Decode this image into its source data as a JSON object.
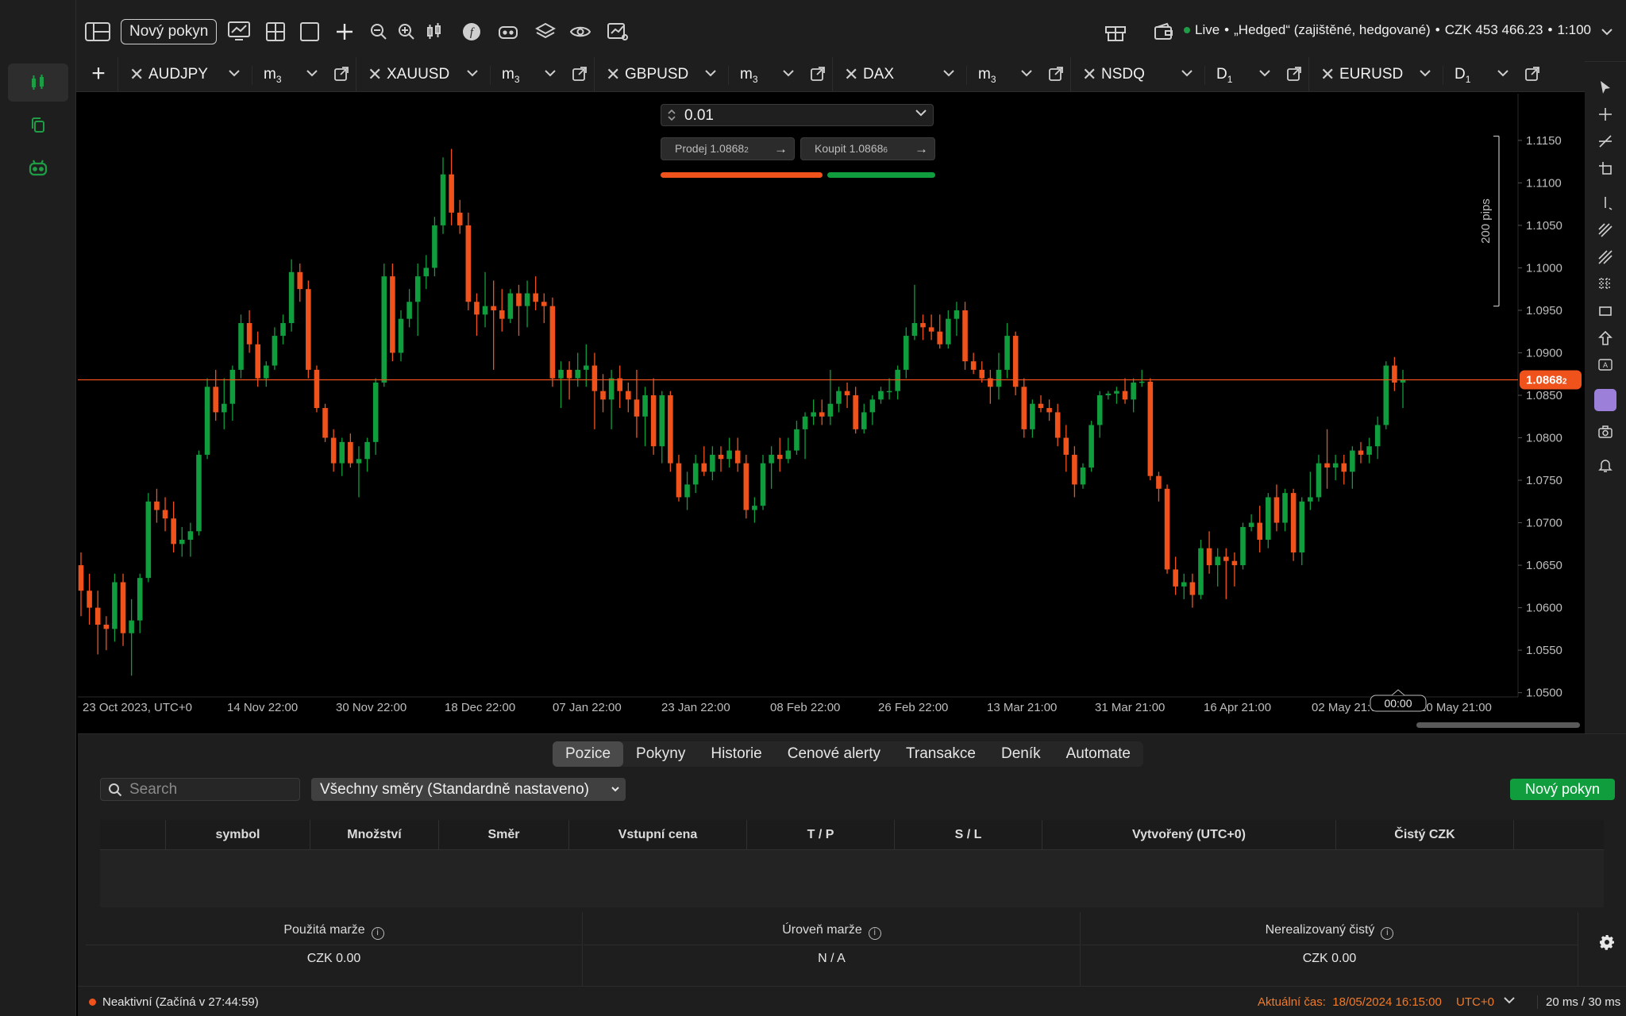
{
  "toolbar": {
    "new_order_label": "Nový pokyn",
    "account_status": "Live",
    "account_name": "„Hedged“ (zajištěné, hedgované)",
    "balance": "CZK 453 466.23",
    "leverage": "1:100",
    "icons": [
      "sidebar-toggle-icon",
      "chart-icon",
      "layout-grid-icon",
      "single-layout-icon",
      "crosshair-add-icon",
      "zoom-out-icon",
      "zoom-in-icon",
      "candles-icon",
      "indicator-f-icon",
      "bot-icon",
      "layers-icon",
      "eye-icon",
      "chart-settings-icon",
      "gift-icon",
      "wallet-icon"
    ]
  },
  "left_sidebar": {
    "items": [
      "trading-icon",
      "copy-icon",
      "automate-icon"
    ]
  },
  "tabs": [
    {
      "symbol": "AUDJPY",
      "timeframe": "m",
      "tf_sub": "3"
    },
    {
      "symbol": "XAUUSD",
      "timeframe": "m",
      "tf_sub": "3"
    },
    {
      "symbol": "GBPUSD",
      "timeframe": "m",
      "tf_sub": "3"
    },
    {
      "symbol": "DAX",
      "timeframe": "m",
      "tf_sub": "3"
    },
    {
      "symbol": "NSDQ",
      "timeframe": "D",
      "tf_sub": "1"
    },
    {
      "symbol": "EURUSD",
      "timeframe": "D",
      "tf_sub": "1"
    }
  ],
  "trade_panel": {
    "quantity": "0.01",
    "sell_label": "Prodej 1.0868",
    "sell_sup": "2",
    "buy_label": "Koupit 1.0868",
    "buy_sup": "6"
  },
  "chart_data": {
    "type": "candlestick",
    "symbol": "EURUSD",
    "timeframe": "D1",
    "y_ticks": [
      "1.1150",
      "1.1100",
      "1.1050",
      "1.1000",
      "1.0950",
      "1.0900",
      "1.0850",
      "1.0800",
      "1.0750",
      "1.0700",
      "1.0650",
      "1.0600",
      "1.0550",
      "1.0500"
    ],
    "y_tick_values": [
      1.115,
      1.11,
      1.105,
      1.1,
      1.095,
      1.09,
      1.085,
      1.08,
      1.075,
      1.07,
      1.065,
      1.06,
      1.055,
      1.05
    ],
    "ylim": [
      1.0495,
      1.1205
    ],
    "x_tick_labels": [
      "23 Oct 2023, UTC+0",
      "14 Nov 22:00",
      "30 Nov 22:00",
      "18 Dec 22:00",
      "07 Jan 22:00",
      "23 Jan 22:00",
      "08 Feb 22:00",
      "26 Feb 22:00",
      "13 Mar 21:00",
      "31 Mar 21:00",
      "16 Apr 21:00",
      "02 May 21:00",
      "20 May 21:00"
    ],
    "current_price": "1.0868",
    "current_price_sup": "2",
    "current_price_value": 1.08682,
    "range_label": "200 pips",
    "range_high": 1.1155,
    "range_low": 1.0955,
    "crosshair_time": "00:00",
    "up_color": "#0f9d3d",
    "down_color": "#f0521c",
    "candles": [
      [
        1.065,
        1.0665,
        1.059,
        1.062
      ],
      [
        1.062,
        1.064,
        1.058,
        1.06
      ],
      [
        1.06,
        1.062,
        1.0545,
        1.058
      ],
      [
        1.058,
        1.059,
        1.055,
        1.0575
      ],
      [
        1.0575,
        1.064,
        1.056,
        1.063
      ],
      [
        1.063,
        1.064,
        1.0555,
        1.057
      ],
      [
        1.057,
        1.061,
        1.052,
        1.0585
      ],
      [
        1.0585,
        1.064,
        1.057,
        1.0635
      ],
      [
        1.0635,
        1.0735,
        1.063,
        1.0725
      ],
      [
        1.0725,
        1.074,
        1.07,
        1.0715
      ],
      [
        1.0715,
        1.073,
        1.069,
        1.0705
      ],
      [
        1.0705,
        1.0725,
        1.0665,
        1.0675
      ],
      [
        1.0675,
        1.0695,
        1.066,
        1.068
      ],
      [
        1.068,
        1.07,
        1.066,
        1.069
      ],
      [
        1.069,
        1.0785,
        1.0685,
        1.078
      ],
      [
        1.078,
        1.087,
        1.0775,
        1.086
      ],
      [
        1.086,
        1.088,
        1.082,
        1.083
      ],
      [
        1.083,
        1.087,
        1.081,
        1.084
      ],
      [
        1.084,
        1.0885,
        1.082,
        1.088
      ],
      [
        1.088,
        1.0945,
        1.087,
        1.0935
      ],
      [
        1.0935,
        1.095,
        1.09,
        1.091
      ],
      [
        1.091,
        1.0925,
        1.086,
        1.087
      ],
      [
        1.087,
        1.089,
        1.086,
        1.0885
      ],
      [
        1.0885,
        1.093,
        1.088,
        1.092
      ],
      [
        1.092,
        1.0945,
        1.091,
        1.0935
      ],
      [
        1.0935,
        1.101,
        1.0925,
        1.0995
      ],
      [
        1.0995,
        1.1005,
        1.096,
        1.0975
      ],
      [
        1.0975,
        1.0985,
        1.087,
        1.088
      ],
      [
        1.088,
        1.0885,
        1.083,
        1.0835
      ],
      [
        1.0835,
        1.084,
        1.0795,
        1.08
      ],
      [
        1.08,
        1.081,
        1.076,
        1.077
      ],
      [
        1.077,
        1.08,
        1.0755,
        1.0795
      ],
      [
        1.0795,
        1.0805,
        1.0765,
        1.077
      ],
      [
        1.077,
        1.079,
        1.073,
        1.0775
      ],
      [
        1.0775,
        1.08,
        1.076,
        1.0795
      ],
      [
        1.0795,
        1.087,
        1.078,
        1.0865
      ],
      [
        1.0865,
        1.1005,
        1.086,
        1.099
      ],
      [
        1.099,
        1.1005,
        1.089,
        1.09
      ],
      [
        1.09,
        1.095,
        1.089,
        1.094
      ],
      [
        1.094,
        1.0975,
        1.093,
        1.096
      ],
      [
        1.096,
        1.1005,
        1.092,
        1.099
      ],
      [
        1.099,
        1.1015,
        1.0975,
        1.1
      ],
      [
        1.1,
        1.106,
        1.099,
        1.105
      ],
      [
        1.105,
        1.113,
        1.104,
        1.111
      ],
      [
        1.111,
        1.114,
        1.105,
        1.1065
      ],
      [
        1.1065,
        1.108,
        1.104,
        1.105
      ],
      [
        1.105,
        1.1065,
        1.095,
        1.096
      ],
      [
        1.096,
        1.097,
        1.092,
        1.0945
      ],
      [
        1.0945,
        1.0995,
        1.093,
        1.0955
      ],
      [
        1.0955,
        1.0985,
        1.088,
        1.095
      ],
      [
        1.095,
        1.0975,
        1.0925,
        1.094
      ],
      [
        1.094,
        1.0975,
        1.0935,
        1.097
      ],
      [
        1.097,
        1.098,
        1.092,
        1.0955
      ],
      [
        1.0955,
        1.0985,
        1.093,
        1.097
      ],
      [
        1.097,
        1.099,
        1.095,
        1.096
      ],
      [
        1.096,
        1.097,
        1.0935,
        1.0955
      ],
      [
        1.0955,
        1.0965,
        1.086,
        1.087
      ],
      [
        1.087,
        1.089,
        1.0835,
        1.088
      ],
      [
        1.088,
        1.089,
        1.0845,
        1.087
      ],
      [
        1.087,
        1.09,
        1.086,
        1.088
      ],
      [
        1.088,
        1.091,
        1.086,
        1.0885
      ],
      [
        1.0885,
        1.09,
        1.081,
        1.0855
      ],
      [
        1.0855,
        1.0875,
        1.083,
        1.0845
      ],
      [
        1.0845,
        1.088,
        1.081,
        1.087
      ],
      [
        1.087,
        1.0885,
        1.0835,
        1.0855
      ],
      [
        1.0855,
        1.0865,
        1.083,
        1.0845
      ],
      [
        1.0845,
        1.088,
        1.08,
        1.0825
      ],
      [
        1.0825,
        1.086,
        1.079,
        1.085
      ],
      [
        1.085,
        1.087,
        1.078,
        1.079
      ],
      [
        1.079,
        1.0855,
        1.077,
        1.085
      ],
      [
        1.085,
        1.0855,
        1.076,
        1.077
      ],
      [
        1.077,
        1.078,
        1.0725,
        1.073
      ],
      [
        1.073,
        1.076,
        1.0715,
        1.0745
      ],
      [
        1.0745,
        1.078,
        1.0735,
        1.077
      ],
      [
        1.077,
        1.079,
        1.0755,
        1.076
      ],
      [
        1.076,
        1.079,
        1.075,
        1.078
      ],
      [
        1.078,
        1.079,
        1.076,
        1.0775
      ],
      [
        1.0775,
        1.08,
        1.0765,
        1.0785
      ],
      [
        1.0785,
        1.08,
        1.076,
        1.077
      ],
      [
        1.077,
        1.078,
        1.0705,
        1.0715
      ],
      [
        1.0715,
        1.073,
        1.07,
        1.072
      ],
      [
        1.072,
        1.078,
        1.0715,
        1.077
      ],
      [
        1.077,
        1.079,
        1.074,
        1.078
      ],
      [
        1.078,
        1.08,
        1.076,
        1.0775
      ],
      [
        1.0775,
        1.08,
        1.077,
        1.0785
      ],
      [
        1.0785,
        1.082,
        1.078,
        1.081
      ],
      [
        1.081,
        1.083,
        1.0775,
        1.0825
      ],
      [
        1.0825,
        1.0845,
        1.0815,
        1.083
      ],
      [
        1.083,
        1.0845,
        1.0815,
        1.0825
      ],
      [
        1.0825,
        1.088,
        1.0815,
        1.084
      ],
      [
        1.084,
        1.086,
        1.083,
        1.0855
      ],
      [
        1.0855,
        1.0865,
        1.0835,
        1.085
      ],
      [
        1.085,
        1.086,
        1.0805,
        1.081
      ],
      [
        1.081,
        1.084,
        1.0805,
        1.083
      ],
      [
        1.083,
        1.085,
        1.0815,
        1.0845
      ],
      [
        1.0845,
        1.086,
        1.084,
        1.0855
      ],
      [
        1.0855,
        1.087,
        1.0845,
        1.0855
      ],
      [
        1.0855,
        1.0885,
        1.0845,
        1.088
      ],
      [
        1.088,
        1.093,
        1.087,
        1.092
      ],
      [
        1.092,
        1.098,
        1.0915,
        1.0935
      ],
      [
        1.0935,
        1.0945,
        1.0915,
        1.093
      ],
      [
        1.093,
        1.0945,
        1.0915,
        1.0925
      ],
      [
        1.0925,
        1.0945,
        1.0905,
        1.091
      ],
      [
        1.091,
        1.095,
        1.0905,
        1.094
      ],
      [
        1.094,
        1.096,
        1.092,
        1.095
      ],
      [
        1.095,
        1.096,
        1.088,
        1.089
      ],
      [
        1.089,
        1.09,
        1.0875,
        1.088
      ],
      [
        1.088,
        1.089,
        1.0865,
        1.087
      ],
      [
        1.087,
        1.088,
        1.084,
        1.086
      ],
      [
        1.086,
        1.09,
        1.0845,
        1.088
      ],
      [
        1.088,
        1.0935,
        1.087,
        1.092
      ],
      [
        1.092,
        1.0925,
        1.085,
        1.086
      ],
      [
        1.086,
        1.087,
        1.08,
        1.081
      ],
      [
        1.081,
        1.0845,
        1.08,
        1.084
      ],
      [
        1.084,
        1.085,
        1.083,
        1.0835
      ],
      [
        1.0835,
        1.0845,
        1.082,
        1.083
      ],
      [
        1.083,
        1.084,
        1.079,
        1.08
      ],
      [
        1.08,
        1.0815,
        1.076,
        1.078
      ],
      [
        1.078,
        1.079,
        1.073,
        1.0745
      ],
      [
        1.0745,
        1.077,
        1.074,
        1.0765
      ],
      [
        1.0765,
        1.082,
        1.076,
        1.0815
      ],
      [
        1.0815,
        1.0855,
        1.08,
        1.085
      ],
      [
        1.085,
        1.0855,
        1.0845,
        1.0852
      ],
      [
        1.0852,
        1.086,
        1.084,
        1.0855
      ],
      [
        1.0855,
        1.087,
        1.084,
        1.0845
      ],
      [
        1.0845,
        1.087,
        1.083,
        1.0865
      ],
      [
        1.0865,
        1.088,
        1.086,
        1.0866
      ],
      [
        1.0866,
        1.087,
        1.075,
        1.0755
      ],
      [
        1.0755,
        1.076,
        1.0725,
        1.074
      ],
      [
        1.074,
        1.0745,
        1.064,
        1.0645
      ],
      [
        1.0645,
        1.066,
        1.0615,
        1.0625
      ],
      [
        1.0625,
        1.064,
        1.061,
        1.063
      ],
      [
        1.063,
        1.064,
        1.06,
        1.0615
      ],
      [
        1.0615,
        1.068,
        1.061,
        1.067
      ],
      [
        1.067,
        1.069,
        1.064,
        1.065
      ],
      [
        1.065,
        1.067,
        1.0625,
        1.066
      ],
      [
        1.066,
        1.067,
        1.061,
        1.0655
      ],
      [
        1.0655,
        1.0665,
        1.0625,
        1.065
      ],
      [
        1.065,
        1.07,
        1.0645,
        1.0695
      ],
      [
        1.0695,
        1.071,
        1.069,
        1.07
      ],
      [
        1.07,
        1.072,
        1.0665,
        1.068
      ],
      [
        1.068,
        1.0735,
        1.067,
        1.073
      ],
      [
        1.073,
        1.0745,
        1.069,
        1.07
      ],
      [
        1.07,
        1.074,
        1.069,
        1.0735
      ],
      [
        1.0735,
        1.074,
        1.0655,
        1.0665
      ],
      [
        1.0665,
        1.073,
        1.065,
        1.0725
      ],
      [
        1.0725,
        1.076,
        1.0715,
        1.073
      ],
      [
        1.073,
        1.078,
        1.0725,
        1.077
      ],
      [
        1.077,
        1.081,
        1.074,
        1.0765
      ],
      [
        1.0765,
        1.078,
        1.075,
        1.077
      ],
      [
        1.077,
        1.078,
        1.0745,
        1.076
      ],
      [
        1.076,
        1.079,
        1.074,
        1.0785
      ],
      [
        1.0785,
        1.0795,
        1.077,
        1.078
      ],
      [
        1.078,
        1.08,
        1.077,
        1.079
      ],
      [
        1.079,
        1.0825,
        1.0775,
        1.0815
      ],
      [
        1.0815,
        1.089,
        1.081,
        1.0885
      ],
      [
        1.0885,
        1.0895,
        1.0855,
        1.0865
      ],
      [
        1.0865,
        1.088,
        1.0835,
        1.0868
      ]
    ]
  },
  "bottom_panel": {
    "tabs": [
      "Pozice",
      "Pokyny",
      "Historie",
      "Cenové alerty",
      "Transakce",
      "Deník",
      "Automate"
    ],
    "active_tab": "Pozice",
    "search_placeholder": "Search",
    "direction_filter": "Všechny směry (Standardně nastaveno)",
    "new_order_label": "Nový pokyn",
    "columns": [
      "symbol",
      "Množství",
      "Směr",
      "Vstupní cena",
      "T / P",
      "S / L",
      "Vytvořený (UTC+0)",
      "Čistý CZK"
    ],
    "summary": [
      {
        "label": "Použitá marže",
        "value": "CZK 0.00"
      },
      {
        "label": "Úroveň marže",
        "value": "N / A"
      },
      {
        "label": "Nerealizovaný čistý",
        "value": "CZK 0.00"
      }
    ]
  },
  "status_bar": {
    "session": "Neaktivní (Začíná v 27:44:59)",
    "current_time_label": "Aktuální čas:",
    "current_time": "18/05/2024 16:15:00",
    "timezone": "UTC+0",
    "latency": "20 ms / 30 ms"
  }
}
